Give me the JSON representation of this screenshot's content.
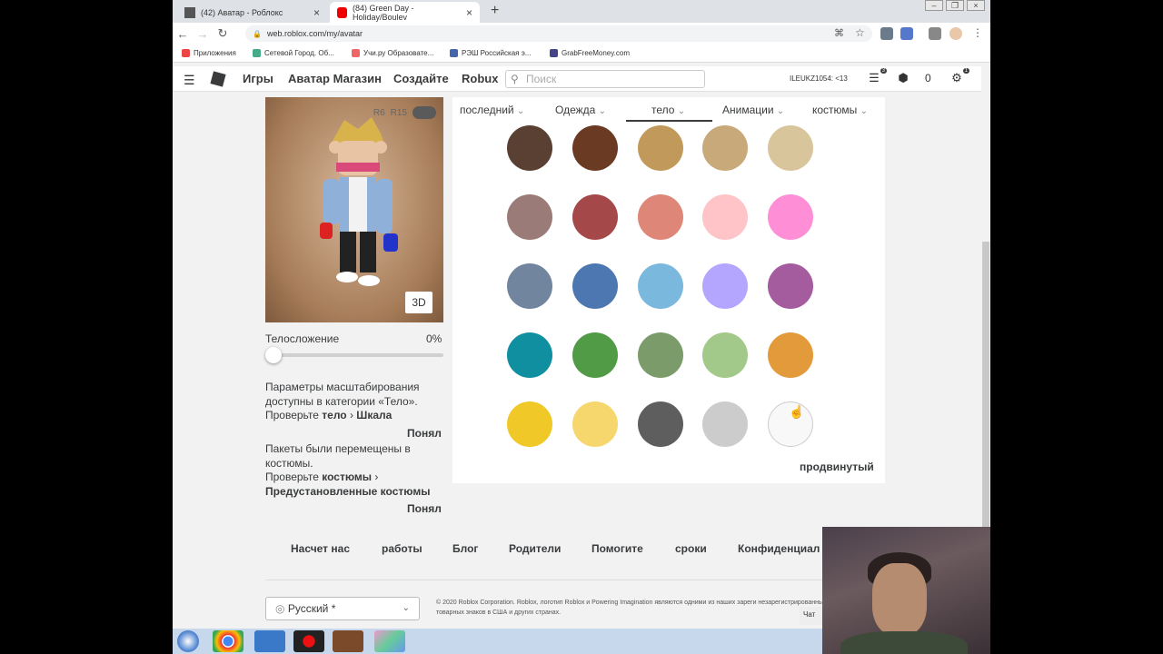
{
  "browser": {
    "tabs": [
      {
        "title": "(42) Аватар - Роблокс"
      },
      {
        "title": "(84) Green Day - Holiday/Boulev"
      }
    ],
    "url": "web.roblox.com/my/avatar",
    "bookmarks": [
      "Приложения",
      "Сетевой Город. Об...",
      "Учи.ру Образовате...",
      "РЭШ Российская э...",
      "GrabFreeMoney.com"
    ]
  },
  "header": {
    "nav": [
      "Игры",
      "Аватар Магазин",
      "Создайте",
      "Robux"
    ],
    "search_placeholder": "Поиск",
    "username": "ILEUKZ1054: <13",
    "notif_count": "3",
    "robux": "0",
    "settings_badge": "1"
  },
  "avatar": {
    "toggle_r6": "R6",
    "toggle_r15": "R15",
    "btn_3d": "3D",
    "build_label": "Телосложение",
    "build_value": "0%",
    "build_level": 0,
    "scale_note_1": "Параметры масштабирования доступны в категории «Тело».",
    "scale_note_check": "Проверьте",
    "scale_note_link1": "тело",
    "scale_note_link2": "Шкала",
    "ok1": "Понял",
    "packages_note": "Пакеты были перемещены в костюмы.",
    "packages_check": "Проверьте",
    "packages_link1": "костюмы",
    "packages_link2": "Предустановленные костюмы",
    "ok2": "Понял"
  },
  "panel": {
    "tabs": [
      "последний",
      "Одежда",
      "тело",
      "Анимации",
      "костюмы"
    ],
    "active_tab": "тело",
    "swatches": [
      "#5a3f33",
      "#6b3a22",
      "#c19a5b",
      "#c8a97a",
      "#d9c59b",
      "#9b7b77",
      "#a4484a",
      "#de8677",
      "#fec4c8",
      "#fe8fd6",
      "#71859e",
      "#4d77b0",
      "#7ab8de",
      "#b4a6ff",
      "#a45c9f",
      "#0f8fa0",
      "#519a46",
      "#7c9b6b",
      "#a2c98a",
      "#e39a3a",
      "#f0c928",
      "#f5d76e",
      "#5e5e5e",
      "#cccccc",
      "#f8f8f8"
    ],
    "advanced": "продвинутый"
  },
  "footer": {
    "links": [
      "Насчет нас",
      "работы",
      "Блог",
      "Родители",
      "Помогите",
      "сроки",
      "Конфиденциал"
    ],
    "language": "Русский *",
    "copyright": "© 2020 Roblox Corporation. Roblox, логотип Roblox и Powering Imagination являются одними из наших зареги незарегистрированных товарных знаков в США и других странах.",
    "chat": "Чат"
  }
}
